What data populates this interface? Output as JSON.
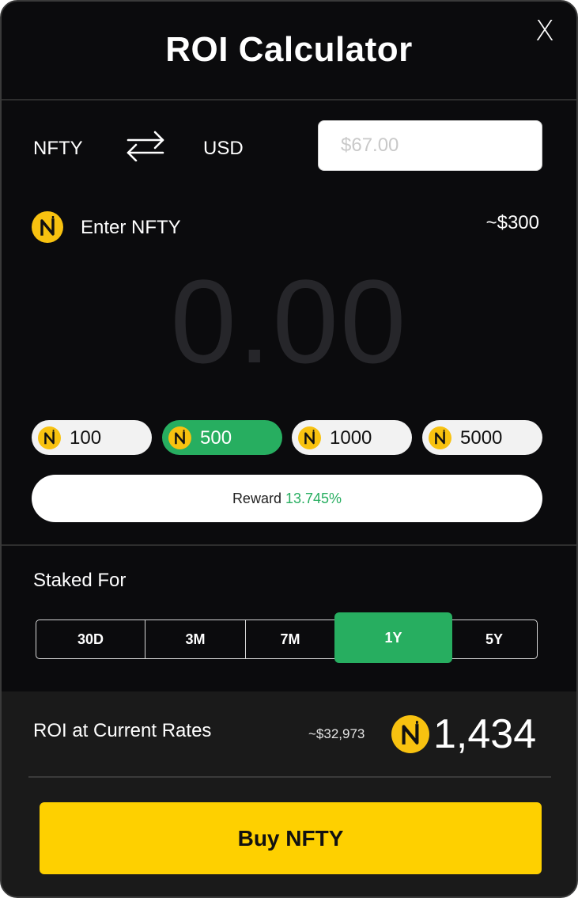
{
  "modal": {
    "title": "ROI Calculator",
    "close_label": "X"
  },
  "converter": {
    "from": "NFTY",
    "to": "USD",
    "usd_placeholder": "$67.00"
  },
  "entry": {
    "label": "Enter NFTY",
    "approx_value": "~$300",
    "amount": "0.00"
  },
  "presets": [
    {
      "label": "100",
      "active": false
    },
    {
      "label": "500",
      "active": true
    },
    {
      "label": "1000",
      "active": false
    },
    {
      "label": "5000",
      "active": false
    }
  ],
  "reward": {
    "label": "Reward",
    "rate": "13.745%"
  },
  "staking": {
    "label": "Staked For",
    "periods": [
      "30D",
      "3M",
      "7M",
      "1Y",
      "5Y"
    ],
    "selected": "1Y"
  },
  "roi": {
    "label": "ROI at Current Rates",
    "usd_value": "~$32,973",
    "token_value": "1,434"
  },
  "buy_button": "Buy NFTY",
  "colors": {
    "background": "#0b0b0d",
    "accent_green": "#27ae60",
    "coin_yellow": "#f8c210",
    "buy_yellow": "#fed000"
  },
  "icons": {
    "swap": "swap-arrows-icon",
    "coin": "nfty-coin-icon",
    "close": "close-icon"
  }
}
